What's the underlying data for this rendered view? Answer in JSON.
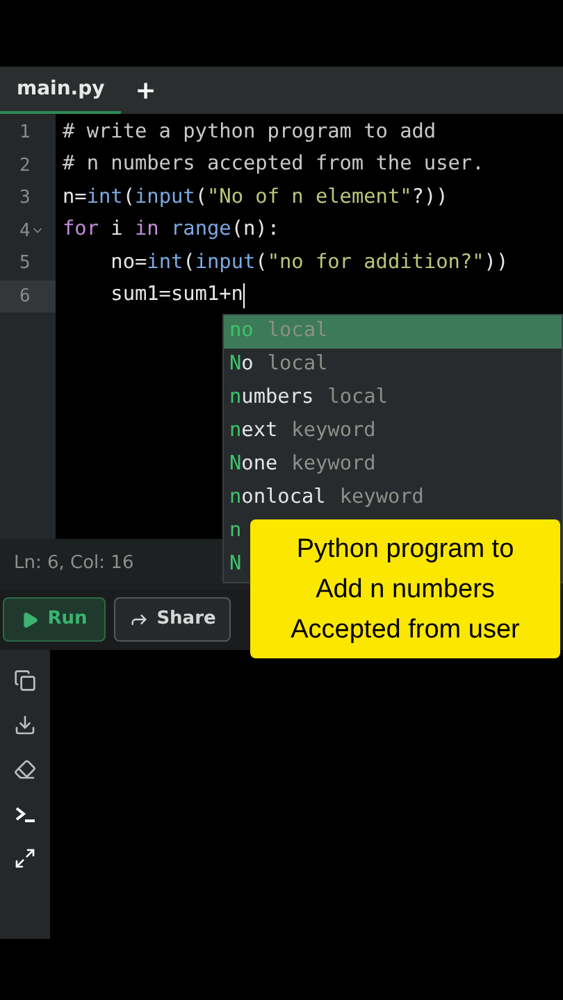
{
  "tabs": [
    {
      "label": "main.py",
      "selected": true
    }
  ],
  "add_tab": "+",
  "code_lines": [
    {
      "number": "1",
      "active": false,
      "foldable": false,
      "tokens": [
        {
          "kind": "comment",
          "text": "# write a python program to add"
        }
      ]
    },
    {
      "number": "2",
      "active": false,
      "foldable": false,
      "tokens": [
        {
          "kind": "comment",
          "text": "# n numbers accepted from the user."
        }
      ]
    },
    {
      "number": "3",
      "active": false,
      "foldable": false,
      "tokens": [
        {
          "kind": "plain",
          "text": "n="
        },
        {
          "kind": "builtin",
          "text": "int"
        },
        {
          "kind": "plain",
          "text": "("
        },
        {
          "kind": "builtin",
          "text": "input"
        },
        {
          "kind": "plain",
          "text": "("
        },
        {
          "kind": "string",
          "text": "\"No of n element\""
        },
        {
          "kind": "plain",
          "text": "?))"
        }
      ]
    },
    {
      "number": "4",
      "active": false,
      "foldable": true,
      "tokens": [
        {
          "kind": "keyword",
          "text": "for"
        },
        {
          "kind": "plain",
          "text": " i "
        },
        {
          "kind": "keyword",
          "text": "in "
        },
        {
          "kind": "builtin",
          "text": "range"
        },
        {
          "kind": "plain",
          "text": "(n):"
        }
      ]
    },
    {
      "number": "5",
      "active": false,
      "foldable": false,
      "tokens": [
        {
          "kind": "plain",
          "text": "    no="
        },
        {
          "kind": "builtin",
          "text": "int"
        },
        {
          "kind": "plain",
          "text": "("
        },
        {
          "kind": "builtin",
          "text": "input"
        },
        {
          "kind": "plain",
          "text": "("
        },
        {
          "kind": "string",
          "text": "\"no for addition?\""
        },
        {
          "kind": "plain",
          "text": "))"
        }
      ]
    },
    {
      "number": "6",
      "active": true,
      "foldable": false,
      "tokens": [
        {
          "kind": "plain",
          "text": "    sum1=sum1+n"
        }
      ]
    }
  ],
  "autocomplete": [
    {
      "match": "no",
      "type": "local",
      "selected": true
    },
    {
      "match": "N",
      "rest": "o",
      "type": "local",
      "selected": false
    },
    {
      "match": "n",
      "rest": "umbers",
      "type": "local",
      "selected": false
    },
    {
      "match": "n",
      "rest": "ext",
      "type": "keyword",
      "selected": false
    },
    {
      "match": "N",
      "rest": "one",
      "type": "keyword",
      "selected": false
    },
    {
      "match": "n",
      "rest": "onlocal",
      "type": "keyword",
      "selected": false
    },
    {
      "match": "n",
      "selected": false
    },
    {
      "match": "N",
      "selected": false
    }
  ],
  "status_bar": "Ln: 6, Col: 16",
  "buttons": [
    {
      "kind": "run",
      "label": "Run"
    },
    {
      "kind": "share",
      "label": "Share"
    }
  ],
  "side_tools": [
    {
      "kind": "copy"
    },
    {
      "kind": "download"
    },
    {
      "kind": "erase"
    },
    {
      "kind": "terminal"
    },
    {
      "kind": "expand"
    }
  ],
  "caption": [
    "Python program to",
    "Add n numbers",
    "Accepted from user"
  ]
}
